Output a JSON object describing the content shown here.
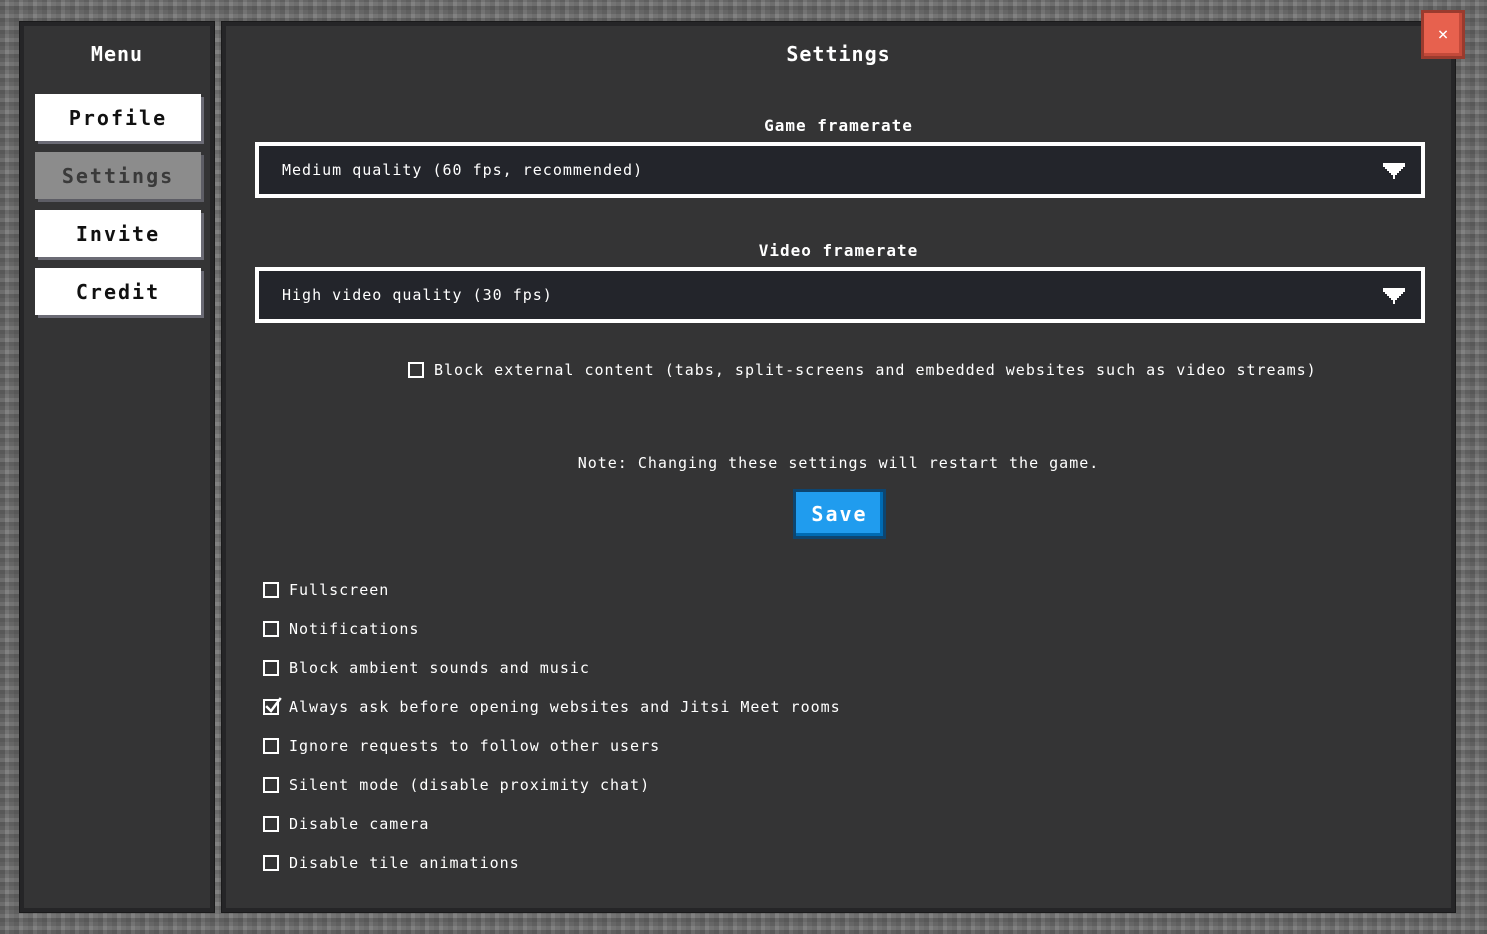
{
  "menu": {
    "title": "Menu",
    "items": [
      {
        "label": "Profile",
        "active": false
      },
      {
        "label": "Settings",
        "active": true
      },
      {
        "label": "Invite",
        "active": false
      },
      {
        "label": "Credit",
        "active": false
      }
    ]
  },
  "settings": {
    "title": "Settings",
    "game_framerate": {
      "label": "Game framerate",
      "value": "Medium quality (60 fps, recommended)"
    },
    "video_framerate": {
      "label": "Video framerate",
      "value": "High video quality (30 fps)"
    },
    "block_external": {
      "label": "Block external content (tabs, split-screens and embedded websites such as video streams)",
      "checked": false
    },
    "note": "Note: Changing these settings will restart the game.",
    "save_label": "Save",
    "options": [
      {
        "label": "Fullscreen",
        "checked": false
      },
      {
        "label": "Notifications",
        "checked": false
      },
      {
        "label": "Block ambient sounds and music",
        "checked": false
      },
      {
        "label": "Always ask before opening websites and Jitsi Meet rooms",
        "checked": true
      },
      {
        "label": "Ignore requests to follow other users",
        "checked": false
      },
      {
        "label": "Silent mode (disable proximity chat)",
        "checked": false
      },
      {
        "label": "Disable camera",
        "checked": false
      },
      {
        "label": "Disable tile animations",
        "checked": false
      }
    ]
  },
  "close_label": "×",
  "colors": {
    "panel": "#343435",
    "save": "#209cee",
    "close": "#e7614e"
  }
}
